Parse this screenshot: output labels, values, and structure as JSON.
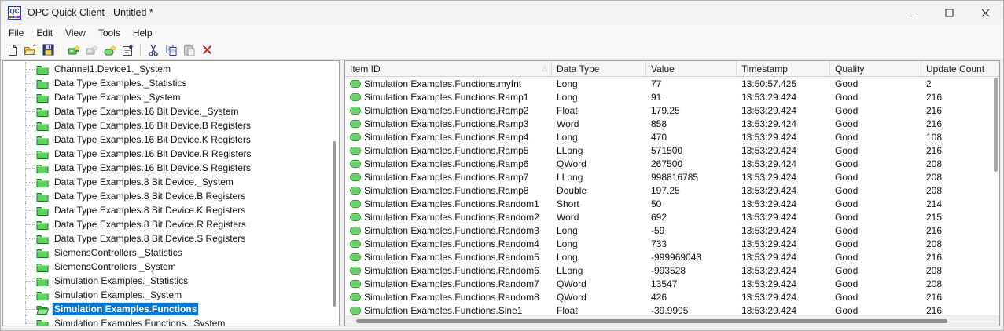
{
  "window": {
    "title": "OPC Quick Client - Untitled *",
    "app_icon_text": "QC",
    "controls": [
      {
        "name": "minimize-button",
        "glyph": "minimize-icon"
      },
      {
        "name": "maximize-button",
        "glyph": "maximize-icon"
      },
      {
        "name": "close-button",
        "glyph": "close-icon"
      }
    ]
  },
  "menu_bar": {
    "items": [
      "File",
      "Edit",
      "View",
      "Tools",
      "Help"
    ]
  },
  "toolbar": {
    "buttons": [
      {
        "name": "new-file",
        "icon": "new-document-icon",
        "enabled": true
      },
      {
        "name": "open-file",
        "icon": "open-folder-icon",
        "enabled": true
      },
      {
        "name": "save",
        "icon": "save-icon",
        "enabled": true
      },
      {
        "name": "new-server-connection",
        "icon": "new-server-icon",
        "enabled": true
      },
      {
        "name": "new-group",
        "icon": "new-group-icon",
        "enabled": false
      },
      {
        "name": "new-item",
        "icon": "new-item-icon",
        "enabled": true
      },
      {
        "name": "properties",
        "icon": "properties-icon",
        "enabled": true
      },
      {
        "name": "cut",
        "icon": "cut-icon",
        "enabled": true
      },
      {
        "name": "copy",
        "icon": "copy-icon",
        "enabled": true
      },
      {
        "name": "paste",
        "icon": "paste-icon",
        "enabled": false
      },
      {
        "name": "delete",
        "icon": "delete-icon",
        "enabled": true
      }
    ]
  },
  "tree": {
    "items": [
      {
        "label": "Channel1.Device1._System",
        "selected": false
      },
      {
        "label": "Data Type Examples._Statistics",
        "selected": false
      },
      {
        "label": "Data Type Examples._System",
        "selected": false
      },
      {
        "label": "Data Type Examples.16 Bit Device._System",
        "selected": false
      },
      {
        "label": "Data Type Examples.16 Bit Device.B Registers",
        "selected": false
      },
      {
        "label": "Data Type Examples.16 Bit Device.K Registers",
        "selected": false
      },
      {
        "label": "Data Type Examples.16 Bit Device.R Registers",
        "selected": false
      },
      {
        "label": "Data Type Examples.16 Bit Device.S Registers",
        "selected": false
      },
      {
        "label": "Data Type Examples.8 Bit Device._System",
        "selected": false
      },
      {
        "label": "Data Type Examples.8 Bit Device.B Registers",
        "selected": false
      },
      {
        "label": "Data Type Examples.8 Bit Device.K Registers",
        "selected": false
      },
      {
        "label": "Data Type Examples.8 Bit Device.R Registers",
        "selected": false
      },
      {
        "label": "Data Type Examples.8 Bit Device.S Registers",
        "selected": false
      },
      {
        "label": "SiemensControllers._Statistics",
        "selected": false
      },
      {
        "label": "SiemensControllers._System",
        "selected": false
      },
      {
        "label": "Simulation Examples._Statistics",
        "selected": false
      },
      {
        "label": "Simulation Examples._System",
        "selected": false
      },
      {
        "label": "Simulation Examples.Functions",
        "selected": true
      },
      {
        "label": "Simulation Examples.Functions._System",
        "selected": false
      }
    ]
  },
  "table": {
    "columns": [
      "Item ID",
      "Data Type",
      "Value",
      "Timestamp",
      "Quality",
      "Update Count"
    ],
    "sort": {
      "column": "Item ID",
      "direction": "asc"
    },
    "rows": [
      {
        "item_id": "Simulation Examples.Functions.myInt",
        "data_type": "Long",
        "value": "77",
        "timestamp": "13:50:57.425",
        "quality": "Good",
        "update_count": "2"
      },
      {
        "item_id": "Simulation Examples.Functions.Ramp1",
        "data_type": "Long",
        "value": "91",
        "timestamp": "13:53:29.424",
        "quality": "Good",
        "update_count": "216"
      },
      {
        "item_id": "Simulation Examples.Functions.Ramp2",
        "data_type": "Float",
        "value": "179.25",
        "timestamp": "13:53:29.424",
        "quality": "Good",
        "update_count": "216"
      },
      {
        "item_id": "Simulation Examples.Functions.Ramp3",
        "data_type": "Word",
        "value": "858",
        "timestamp": "13:53:29.424",
        "quality": "Good",
        "update_count": "216"
      },
      {
        "item_id": "Simulation Examples.Functions.Ramp4",
        "data_type": "Long",
        "value": "470",
        "timestamp": "13:53:29.424",
        "quality": "Good",
        "update_count": "108"
      },
      {
        "item_id": "Simulation Examples.Functions.Ramp5",
        "data_type": "LLong",
        "value": "571500",
        "timestamp": "13:53:29.424",
        "quality": "Good",
        "update_count": "216"
      },
      {
        "item_id": "Simulation Examples.Functions.Ramp6",
        "data_type": "QWord",
        "value": "267500",
        "timestamp": "13:53:29.424",
        "quality": "Good",
        "update_count": "208"
      },
      {
        "item_id": "Simulation Examples.Functions.Ramp7",
        "data_type": "LLong",
        "value": "998816785",
        "timestamp": "13:53:29.424",
        "quality": "Good",
        "update_count": "208"
      },
      {
        "item_id": "Simulation Examples.Functions.Ramp8",
        "data_type": "Double",
        "value": "197.25",
        "timestamp": "13:53:29.424",
        "quality": "Good",
        "update_count": "208"
      },
      {
        "item_id": "Simulation Examples.Functions.Random1",
        "data_type": "Short",
        "value": "50",
        "timestamp": "13:53:29.424",
        "quality": "Good",
        "update_count": "214"
      },
      {
        "item_id": "Simulation Examples.Functions.Random2",
        "data_type": "Word",
        "value": "692",
        "timestamp": "13:53:29.424",
        "quality": "Good",
        "update_count": "215"
      },
      {
        "item_id": "Simulation Examples.Functions.Random3",
        "data_type": "Long",
        "value": "-59",
        "timestamp": "13:53:29.424",
        "quality": "Good",
        "update_count": "216"
      },
      {
        "item_id": "Simulation Examples.Functions.Random4",
        "data_type": "Long",
        "value": "733",
        "timestamp": "13:53:29.424",
        "quality": "Good",
        "update_count": "208"
      },
      {
        "item_id": "Simulation Examples.Functions.Random5",
        "data_type": "Long",
        "value": "-999969043",
        "timestamp": "13:53:29.424",
        "quality": "Good",
        "update_count": "216"
      },
      {
        "item_id": "Simulation Examples.Functions.Random6",
        "data_type": "LLong",
        "value": "-993528",
        "timestamp": "13:53:29.424",
        "quality": "Good",
        "update_count": "208"
      },
      {
        "item_id": "Simulation Examples.Functions.Random7",
        "data_type": "QWord",
        "value": "13547",
        "timestamp": "13:53:29.424",
        "quality": "Good",
        "update_count": "208"
      },
      {
        "item_id": "Simulation Examples.Functions.Random8",
        "data_type": "QWord",
        "value": "426",
        "timestamp": "13:53:29.424",
        "quality": "Good",
        "update_count": "216"
      },
      {
        "item_id": "Simulation Examples.Functions.Sine1",
        "data_type": "Float",
        "value": "-39.9995",
        "timestamp": "13:53:29.424",
        "quality": "Good",
        "update_count": "216"
      }
    ]
  },
  "colors": {
    "selection_blue": "#0078d7",
    "folder_green": "#5fd35f",
    "toolbar_delete_red": "#c42b1c"
  }
}
